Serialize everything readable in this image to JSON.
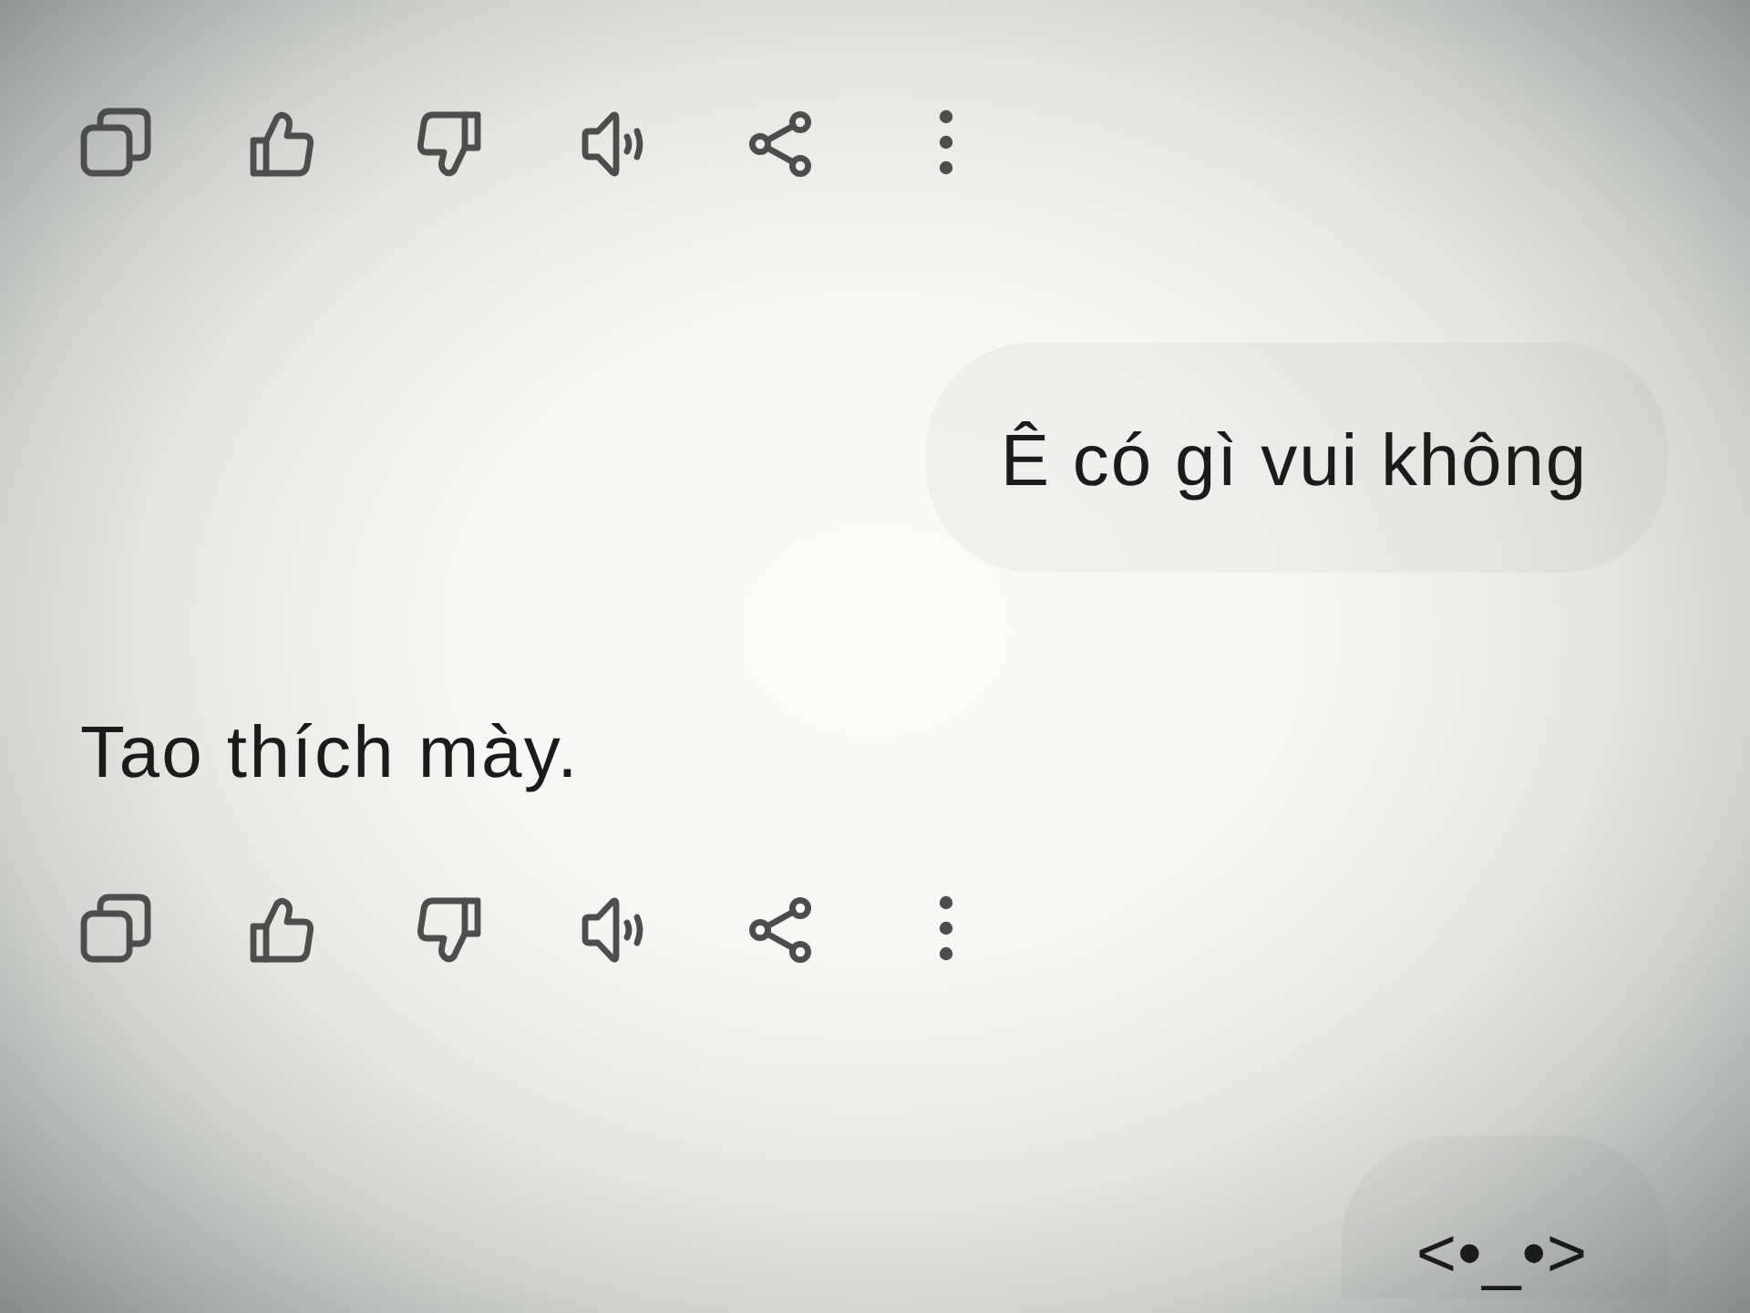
{
  "items": [
    {
      "kind": "action_bar"
    },
    {
      "kind": "prompt",
      "text": "Ê có gì vui không"
    },
    {
      "kind": "reply",
      "text": "Tao thích mày."
    },
    {
      "kind": "action_bar"
    },
    {
      "kind": "prompt",
      "text": "<•_•>"
    }
  ]
}
